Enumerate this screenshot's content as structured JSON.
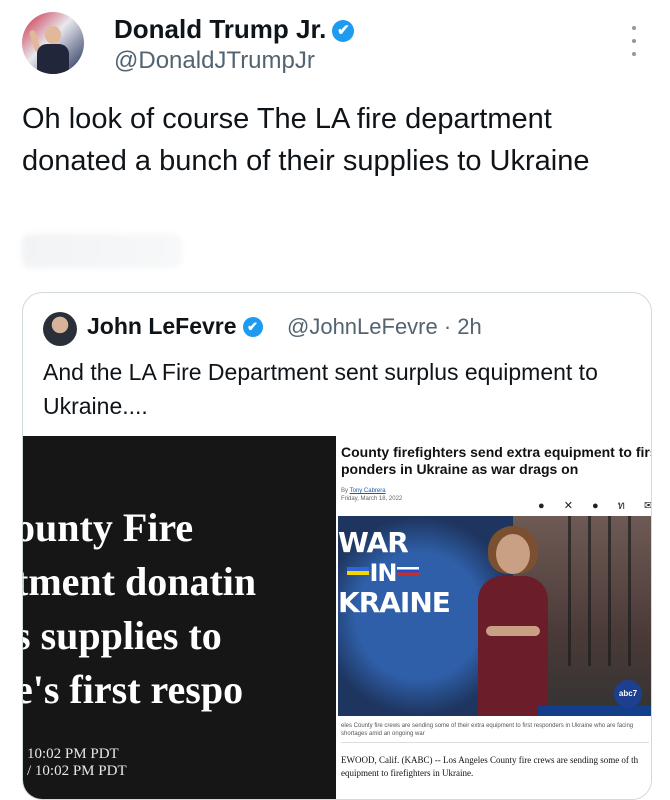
{
  "tweet": {
    "author_name": "Donald Trump Jr.",
    "author_handle": "@DonaldJTrumpJr",
    "verified_mark": "✔",
    "text": "Oh look of course The LA fire department donated a bunch of their supplies to Ukraine"
  },
  "quote": {
    "author_name": "John LeFevre",
    "verified_mark": "✔",
    "meta": "@JohnLeFevre · 2h",
    "text": "And the LA Fire Department sent surplus equipment to Ukraine....",
    "media_left": {
      "headline_lines": [
        "ounty Fire",
        "tment donatin",
        "s supplies to",
        "e's first respo"
      ],
      "time_lines": [
        "10:02 PM PDT",
        "/ 10:02 PM PDT"
      ]
    },
    "media_right": {
      "headline": "County firefighters send extra equipment to firs ponders in Ukraine as war drags on",
      "byline_prefix": "By",
      "byline_author": "Tony Cabrera",
      "date": "Friday, March 18, 2022",
      "share_icons": "● ✕ ● ท ✉",
      "video_text": {
        "war": "WAR",
        "in": "IN",
        "kraine": "KRAINE"
      },
      "logo": "abc7",
      "caption": "eles County fire crews are sending some of their extra equipment to first responders in Ukraine who are facing shortages amid an ongoing war",
      "body": "EWOOD, Calif. (KABC) -- Los Angeles County fire crews are sending some of th equipment to firefighters in Ukraine."
    }
  },
  "colors": {
    "accent_verified": "#1d9bf0",
    "text_primary": "#0f1419",
    "text_secondary": "#536471",
    "border": "#cfd9de"
  }
}
